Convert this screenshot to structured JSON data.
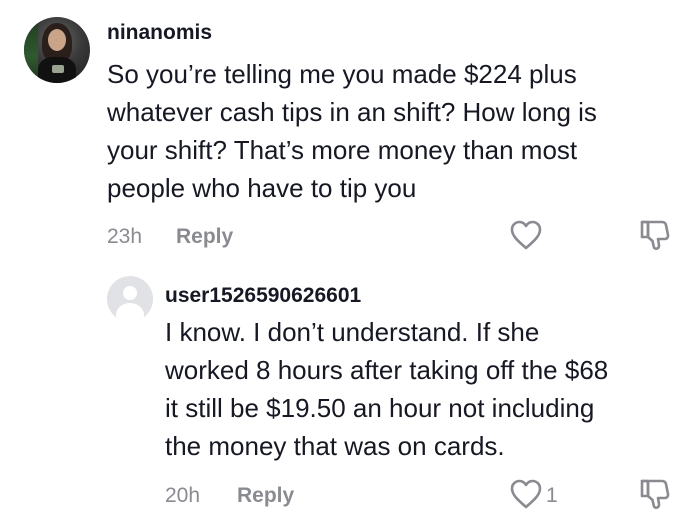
{
  "comment": {
    "username": "ninanomis",
    "lines": [
      "So you’re telling me you made $224 plus",
      "whatever cash tips in an shift? How long is",
      "your shift? That’s more money than most",
      "people who have to tip you"
    ],
    "time": "23h",
    "reply_label": "Reply",
    "avatar_icon": "user-photo-avatar",
    "like_icon": "heart-outline-icon",
    "dislike_icon": "thumbs-down-icon"
  },
  "reply": {
    "username": "user1526590626601",
    "lines": [
      "I know. I don’t understand. If she",
      "worked 8 hours after taking off the $68",
      "it still be $19.50 an hour not including",
      "the money that was on cards."
    ],
    "time": "20h",
    "reply_label": "Reply",
    "like_count": "1",
    "avatar_icon": "default-user-avatar",
    "like_icon": "heart-outline-icon",
    "dislike_icon": "thumbs-down-icon"
  },
  "colors": {
    "text_primary": "#161823",
    "text_secondary": "#8a8b91",
    "icon_stroke": "#8a8b91",
    "background": "#ffffff"
  }
}
